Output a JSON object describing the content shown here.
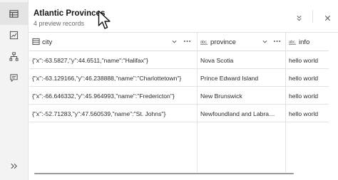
{
  "rail": {
    "items": [
      {
        "name": "table-icon",
        "active": true
      },
      {
        "name": "chart-icon",
        "active": false
      },
      {
        "name": "hierarchy-icon",
        "active": false
      },
      {
        "name": "comment-icon",
        "active": false
      }
    ],
    "expand_icon": "double-chevron-right-icon"
  },
  "header": {
    "title": "Atlantic Provinces",
    "subtitle": "4 preview records",
    "collapse_icon": "double-chevron-down-icon",
    "close_icon": "close-icon"
  },
  "table": {
    "columns": [
      {
        "label": "city",
        "icon": "table-field-icon",
        "has_menu": true
      },
      {
        "label": "province",
        "icon": "string-field-icon",
        "has_menu": true
      },
      {
        "label": "info",
        "icon": "string-field-icon",
        "has_menu": false
      }
    ],
    "rows": [
      [
        "{\"x\":-63.5827,\"y\":44.6511,\"name\":\"Halifax\"}",
        "Nova Scotia",
        "hello world"
      ],
      [
        "{\"x\":-63.129166,\"y\":46.238888,\"name\":\"Charlottetown\"}",
        "Prince Edward Island",
        "hello world"
      ],
      [
        "{\"x\":-66.646332,\"y\":45.964993,\"name\":\"Fredericton\"}",
        "New Brunswick",
        "hello world"
      ],
      [
        "{\"x\":-52.71283,\"y\":47.560539,\"name\":\"St. Johns\"}",
        "Newfoundland and Labra…",
        "hello world"
      ]
    ]
  },
  "colors": {
    "rail_bg": "#f3f3f3",
    "active_item_bg": "#e4e4e4",
    "border": "#e2e2e2",
    "text": "#2b2b2b"
  }
}
